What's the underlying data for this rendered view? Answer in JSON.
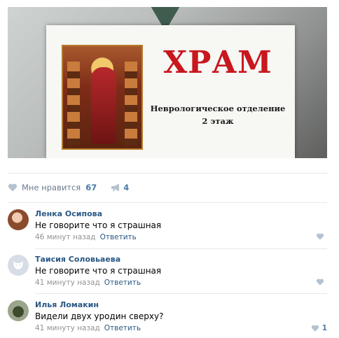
{
  "post": {
    "photo": {
      "title": "ХРАМ",
      "line1": "Неврологическое отделение",
      "line2": "2 этаж"
    },
    "actions": {
      "like_label": "Мне нравится",
      "like_count": "67",
      "share_count": "4"
    }
  },
  "comments": [
    {
      "author": "Ленка Осипова",
      "text": "Не говорите что я страшная",
      "time": "46 минут назад",
      "reply": "Ответить",
      "likes": ""
    },
    {
      "author": "Таисия Соловьаева",
      "text": "Не говорите что я страшная",
      "time": "41 минуту назад",
      "reply": "Ответить",
      "likes": ""
    },
    {
      "author": "Илья Ломакин",
      "text": "Видели двух уродин сверху?",
      "time": "41 минуту назад",
      "reply": "Ответить",
      "likes": "1"
    }
  ],
  "icons": {
    "like": "heart-icon",
    "share": "megaphone-icon"
  },
  "colors": {
    "link": "#2a5885",
    "meta": "#939393",
    "icon": "#b5c2d0",
    "sign_title": "#c8171e"
  }
}
